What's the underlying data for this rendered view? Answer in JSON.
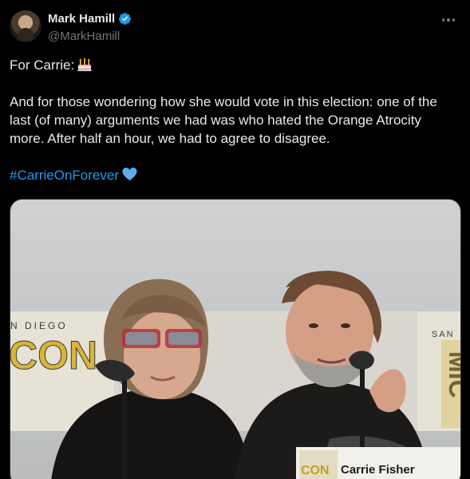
{
  "author": {
    "display_name": "Mark Hamill",
    "handle": "@MarkHamill",
    "verified": true,
    "avatar_icon": "avatar-photo"
  },
  "more_icon": "more-options-icon",
  "tweet": {
    "line1": "For Carrie:",
    "line1_emoji": "birthday-cake-icon",
    "para2": [
      "And for those wondering how she would vote in this election: one of the",
      "last (of many) arguments we had was who hated the Orange Atrocity",
      "more. After half an hour, we had to agree to disagree."
    ],
    "hashtag": "#CarrieOnForever",
    "hashtag_emoji": "blue-heart-icon"
  },
  "media": {
    "name_card": "Carrie Fisher",
    "banner_left": "N DIEGO",
    "banner_con": "CON",
    "banner_right": "SAN",
    "banner_vertical": "MIC",
    "card_logo": "CON",
    "colors": {
      "link": "#1d9bf0",
      "verified": "#1d9bf0",
      "banner_yellow": "#d8b43a"
    }
  }
}
